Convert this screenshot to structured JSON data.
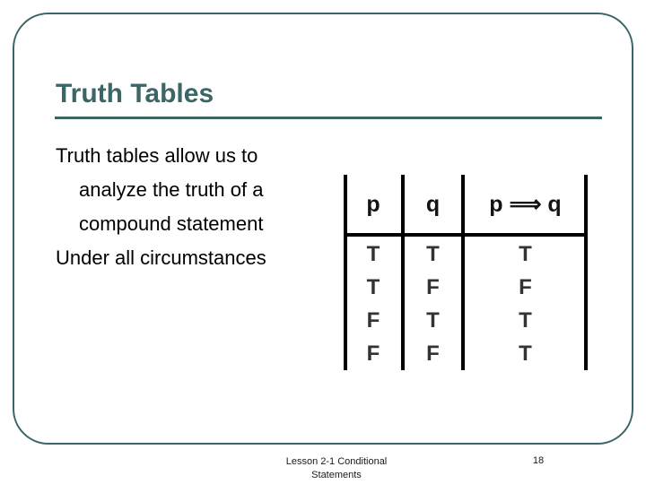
{
  "slide": {
    "title": "Truth Tables",
    "accent_color": "#3c6566",
    "background_color": "#ffffff",
    "body": {
      "paragraphs": [
        "Truth tables allow us to analyze the truth of a compound statement",
        "Under all circumstances"
      ]
    },
    "truth_table": {
      "headers": {
        "col1": "p",
        "col2": "q",
        "col3_left": "p",
        "col3_operator": "⟹",
        "col3_right": "q"
      },
      "rows": [
        {
          "p": "T",
          "q": "T",
          "implication": "T"
        },
        {
          "p": "T",
          "q": "F",
          "implication": "F"
        },
        {
          "p": "F",
          "q": "T",
          "implication": "T"
        },
        {
          "p": "F",
          "q": "F",
          "implication": "T"
        }
      ],
      "column_p": [
        "T",
        "T",
        "F",
        "F"
      ],
      "column_q": [
        "T",
        "F",
        "T",
        "F"
      ],
      "column_implication": [
        "T",
        "F",
        "T",
        "T"
      ]
    },
    "footer": {
      "line1": "Lesson 2-1 Conditional",
      "line2": "Statements",
      "page_number": "18"
    }
  }
}
